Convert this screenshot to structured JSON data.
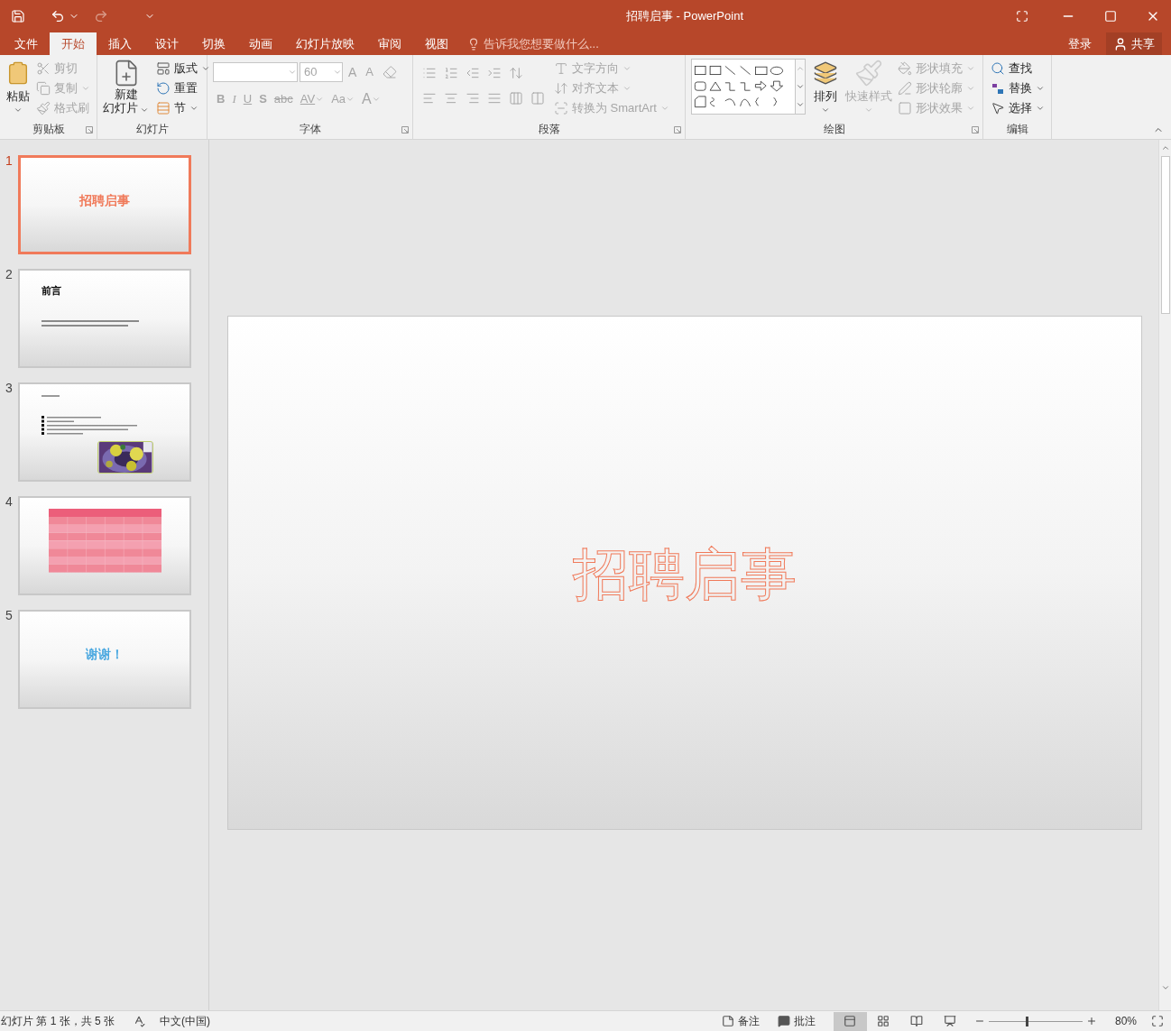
{
  "window": {
    "title": "招聘启事 - PowerPoint"
  },
  "tabs": [
    {
      "label": "文件",
      "selected": false
    },
    {
      "label": "开始",
      "selected": true
    },
    {
      "label": "插入",
      "selected": false
    },
    {
      "label": "设计",
      "selected": false
    },
    {
      "label": "切换",
      "selected": false
    },
    {
      "label": "动画",
      "selected": false
    },
    {
      "label": "幻灯片放映",
      "selected": false
    },
    {
      "label": "审阅",
      "selected": false
    },
    {
      "label": "视图",
      "selected": false
    }
  ],
  "tell_me": {
    "placeholder": "告诉我您想要做什么..."
  },
  "account": {
    "sign_in": "登录",
    "share": "共享"
  },
  "ribbon": {
    "groups": [
      {
        "kind": "clipboard",
        "label": "剪贴板",
        "launcher": true,
        "items": [
          {
            "label": "粘贴",
            "dropdown": true,
            "disabled": false
          },
          {
            "label": "剪切",
            "dropdown": false,
            "disabled": true
          },
          {
            "label": "复制",
            "dropdown": true,
            "disabled": true
          },
          {
            "label": "格式刷",
            "dropdown": false,
            "disabled": true
          }
        ]
      },
      {
        "kind": "slides",
        "label": "幻灯片",
        "launcher": false,
        "items": [
          {
            "lines": [
              "新建",
              "幻灯片"
            ],
            "dropdown": true,
            "disabled": false
          },
          {
            "label": "版式",
            "dropdown": true,
            "disabled": false
          },
          {
            "label": "重置",
            "dropdown": false,
            "disabled": false
          },
          {
            "label": "节",
            "dropdown": true,
            "disabled": false
          }
        ]
      },
      {
        "kind": "font",
        "label": "字体",
        "launcher": true,
        "font_size": "60",
        "disabled": true,
        "items": [
          {
            "label": "A",
            "dropdown": false
          },
          {
            "label": "A",
            "dropdown": false
          },
          {
            "label": "B",
            "dropdown": false
          },
          {
            "label": "I",
            "dropdown": false
          },
          {
            "label": "U",
            "dropdown": false
          },
          {
            "label": "S",
            "dropdown": false
          },
          {
            "label": "abc",
            "dropdown": false
          },
          {
            "label": "AV",
            "dropdown": true
          },
          {
            "label": "Aa",
            "dropdown": true
          },
          {
            "label": "A",
            "dropdown": true
          }
        ]
      },
      {
        "kind": "paragraph",
        "label": "段落",
        "launcher": true,
        "items": [
          {
            "label": "文字方向",
            "dropdown": true,
            "disabled": true
          },
          {
            "label": "对齐文本",
            "dropdown": true,
            "disabled": true
          },
          {
            "label": "转换为 SmartArt",
            "dropdown": true,
            "disabled": true
          }
        ]
      },
      {
        "kind": "drawing",
        "label": "绘图",
        "launcher": true,
        "items": [
          {
            "label": "排列",
            "dropdown": true,
            "disabled": false
          },
          {
            "label": "快速样式",
            "dropdown": true,
            "disabled": true
          },
          {
            "label": "形状填充",
            "dropdown": true,
            "disabled": true
          },
          {
            "label": "形状轮廓",
            "dropdown": true,
            "disabled": true
          },
          {
            "label": "形状效果",
            "dropdown": true,
            "disabled": true
          }
        ]
      },
      {
        "kind": "editing",
        "label": "编辑",
        "launcher": false,
        "items": [
          {
            "label": "查找",
            "dropdown": false,
            "disabled": false
          },
          {
            "label": "替换",
            "dropdown": true,
            "disabled": false
          },
          {
            "label": "选择",
            "dropdown": true,
            "disabled": false
          }
        ]
      }
    ]
  },
  "slides": [
    {
      "number": "1",
      "kind": "title",
      "selected": true,
      "title": "招聘启事",
      "color": "#f07a5a"
    },
    {
      "number": "2",
      "kind": "text",
      "selected": false,
      "title": "前言"
    },
    {
      "number": "3",
      "kind": "bullets",
      "selected": false
    },
    {
      "number": "4",
      "kind": "table",
      "selected": false
    },
    {
      "number": "5",
      "kind": "title",
      "selected": false,
      "title": "谢谢！",
      "color": "#4aa8e0"
    }
  ],
  "current_slide": {
    "title": "招聘启事"
  },
  "status_bar": {
    "slide_info": "幻灯片 第 1 张，共 5 张",
    "language": "中文(中国)",
    "notes": "备注",
    "comments": "批注",
    "views": [
      {
        "selected": true
      },
      {
        "selected": false
      },
      {
        "selected": false
      },
      {
        "selected": false
      }
    ],
    "zoom": {
      "level": 0.4,
      "reading": "80%"
    }
  }
}
